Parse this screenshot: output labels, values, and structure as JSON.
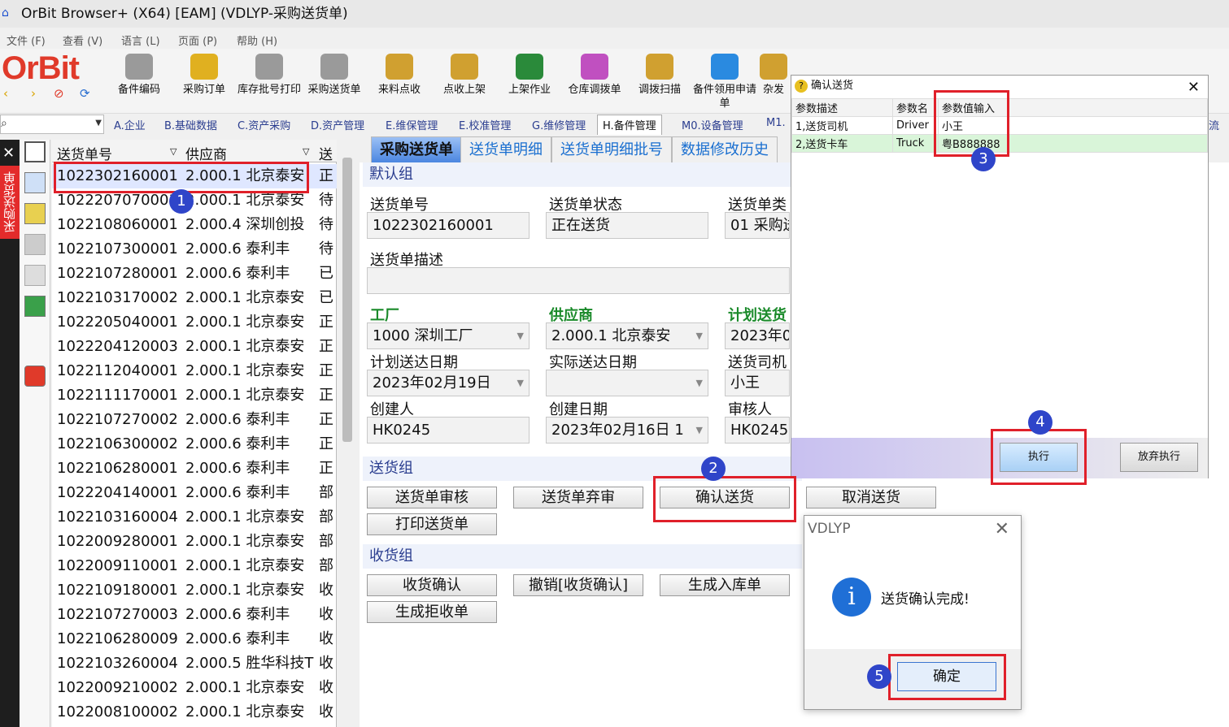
{
  "window": {
    "title": "OrBit Browser+ (X64) [EAM] (VDLYP-采购送货单)"
  },
  "menu": [
    "文件 (F)",
    "查看 (V)",
    "语言 (L)",
    "页面 (P)",
    "帮助 (H)"
  ],
  "brand": "OrBit",
  "toolbar": [
    "备件编码",
    "采购订单",
    "库存批号打印",
    "采购送货单",
    "来料点收",
    "点收上架",
    "上架作业",
    "仓库调拨单",
    "调拨扫描",
    "备件领用申请单",
    "杂发"
  ],
  "modules": [
    "A.企业",
    "B.基础数据",
    "C.资产采购",
    "D.资产管理",
    "E.维保管理",
    "E.校准管理",
    "G.维修管理",
    "H.备件管理",
    "M0.设备管理",
    "M1.",
    "流"
  ],
  "sidebar_label": "采购送货单",
  "list": {
    "headers": [
      "送货单号",
      "供应商",
      "送"
    ],
    "rows": [
      [
        "1022302160001",
        "2.000.1 北京泰安",
        "正"
      ],
      [
        "1022207070001",
        "2.000.1 北京泰安",
        "待"
      ],
      [
        "1022108060001",
        "2.000.4 深圳创投",
        "待"
      ],
      [
        "1022107300001",
        "2.000.6 泰利丰",
        "待"
      ],
      [
        "1022107280001",
        "2.000.6 泰利丰",
        "已"
      ],
      [
        "1022103170002",
        "2.000.1 北京泰安",
        "已"
      ],
      [
        "1022205040001",
        "2.000.1 北京泰安",
        "正"
      ],
      [
        "1022204120003",
        "2.000.1 北京泰安",
        "正"
      ],
      [
        "1022112040001",
        "2.000.1 北京泰安",
        "正"
      ],
      [
        "1022111170001",
        "2.000.1 北京泰安",
        "正"
      ],
      [
        "1022107270002",
        "2.000.6 泰利丰",
        "正"
      ],
      [
        "1022106300002",
        "2.000.6 泰利丰",
        "正"
      ],
      [
        "1022106280001",
        "2.000.6 泰利丰",
        "正"
      ],
      [
        "1022204140001",
        "2.000.6 泰利丰",
        "部"
      ],
      [
        "1022103160004",
        "2.000.1 北京泰安",
        "部"
      ],
      [
        "1022009280001",
        "2.000.1 北京泰安",
        "部"
      ],
      [
        "1022009110001",
        "2.000.1 北京泰安",
        "部"
      ],
      [
        "1022109180001",
        "2.000.1 北京泰安",
        "收"
      ],
      [
        "1022107270003",
        "2.000.6 泰利丰",
        "收"
      ],
      [
        "1022106280009",
        "2.000.6 泰利丰",
        "收"
      ],
      [
        "1022103260004",
        "2.000.5 胜华科技T",
        "收"
      ],
      [
        "1022009210002",
        "2.000.1 北京泰安",
        "收"
      ],
      [
        "1022008100002",
        "2.000.1 北京泰安",
        "收"
      ]
    ]
  },
  "detail_tabs": [
    "采购送货单",
    "送货单明细",
    "送货单明细批号",
    "数据修改历史"
  ],
  "default_group": {
    "title": "默认组",
    "labels": [
      "送货单号",
      "送货单状态",
      "送货单类",
      "送货单描述",
      "工厂",
      "供应商",
      "计划送货",
      "计划送达日期",
      "实际送达日期",
      "送货司机",
      "创建人",
      "创建日期",
      "审核人"
    ],
    "values": [
      "1022302160001",
      "正在送货",
      "01 采购送",
      "",
      "1000 深圳工厂",
      "2.000.1 北京泰安",
      "2023年0",
      "2023年02月19日",
      "",
      "小王",
      "HK0245",
      "2023年02月16日 1",
      "HK0245"
    ]
  },
  "ship_group": {
    "title": "送货组",
    "buttons": [
      "送货单审核",
      "送货单弃审",
      "确认送货",
      "取消送货",
      "打印送货单"
    ]
  },
  "receive_group": {
    "title": "收货组",
    "buttons": [
      "收货确认",
      "撤销[收货确认]",
      "生成入库单",
      "生成拒收单"
    ]
  },
  "dialog_params": {
    "title": "确认送货",
    "headers": [
      "参数描述",
      "参数名",
      "参数值输入"
    ],
    "rows": [
      [
        "1,送货司机",
        "Driver",
        "小王"
      ],
      [
        "2,送货卡车",
        "Truck",
        "粤B888888"
      ]
    ],
    "execute": "执行",
    "abort": "放弃执行"
  },
  "dialog_msg": {
    "title": "VDLYP",
    "message": "送货确认完成!",
    "ok": "确定"
  },
  "badges": [
    "1",
    "2",
    "3",
    "4",
    "5"
  ],
  "colors": {
    "highlight": "#e0202a",
    "badge": "#2f45c9",
    "tab_active": "#4b86e0",
    "brand": "#e03a2a"
  }
}
